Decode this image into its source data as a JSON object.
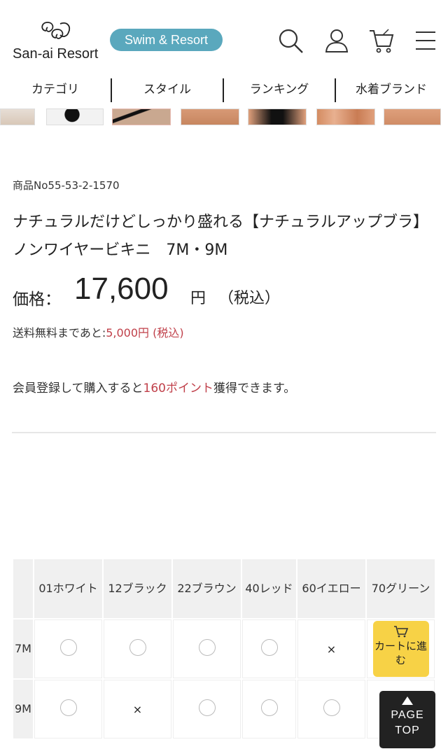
{
  "header": {
    "logo_text": "San-ai Resort",
    "pill_label": "Swim & Resort",
    "icons": [
      "search-icon",
      "account-icon",
      "cart-icon",
      "menu-icon"
    ]
  },
  "nav": {
    "items": [
      "カテゴリ",
      "スタイル",
      "ランキング",
      "水着ブランド"
    ]
  },
  "product": {
    "number": "商品No55-53-2-1570",
    "title": "ナチュラルだけどしっかり盛れる【ナチュラルアップブラ】ノンワイヤービキニ　7M・9M",
    "price_label": "価格：",
    "price": "17,600",
    "price_yen": "円",
    "price_tax": "（税込）",
    "shipping_prefix": "送料無料まであと:",
    "shipping_amount": "5,000円 (税込)",
    "points_prefix": "会員登録して購入すると",
    "points_amount": "160ポイント",
    "points_suffix": "獲得できます。"
  },
  "stock_table": {
    "colors": [
      "01ホワイト",
      "12ブラック",
      "22ブラウン",
      "40レッド",
      "60イエロー",
      "70グリーン"
    ],
    "rows": [
      {
        "size": "7M",
        "status": [
          "circle",
          "circle",
          "circle",
          "circle",
          "cross",
          "cart"
        ]
      },
      {
        "size": "9M",
        "status": [
          "circle",
          "cross",
          "circle",
          "circle",
          "circle",
          "none"
        ]
      }
    ],
    "cross_mark": "×",
    "cart_button_label": "カートに進む"
  },
  "page_top": {
    "line1": "PAGE",
    "line2": "TOP"
  },
  "colors": {
    "accent_pill": "#5aa8bd",
    "price_red": "#c0404a",
    "cart_yellow": "#f7d246",
    "page_top_bg": "#222222"
  }
}
